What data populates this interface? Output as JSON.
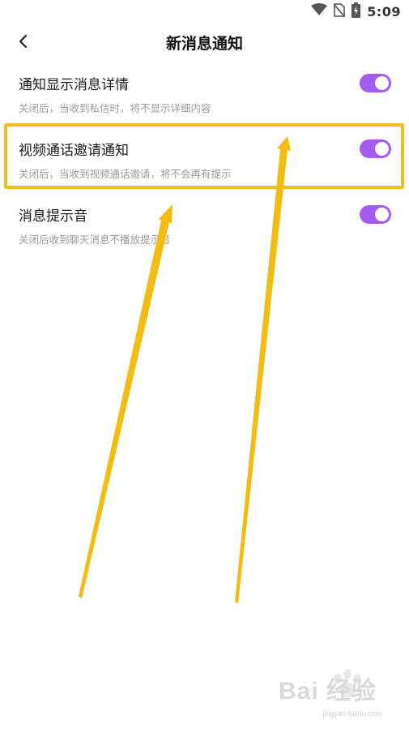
{
  "status_bar": {
    "time": "5:09",
    "icons": [
      "wifi-icon",
      "no-sim-icon",
      "battery-charging-icon"
    ]
  },
  "header": {
    "title": "新消息通知",
    "back_icon": "chevron-left-icon"
  },
  "settings": [
    {
      "title": "通知显示消息详情",
      "description": "关闭后，当收到私信时，将不显示详细内容",
      "enabled": true
    },
    {
      "title": "视频通话邀请通知",
      "description": "关闭后，当收到视频通话邀请，将不会再有提示",
      "enabled": true,
      "highlighted": true
    },
    {
      "title": "消息提示音",
      "description": "关闭后收到聊天消息不播放提示音",
      "enabled": true
    }
  ],
  "colors": {
    "toggle_on": "#a45cf0",
    "highlight": "#f2bd1a",
    "description_text": "#9a9a9a"
  },
  "watermark": {
    "brand": "Bai 经验",
    "url": "jingyan.baidu.com"
  }
}
